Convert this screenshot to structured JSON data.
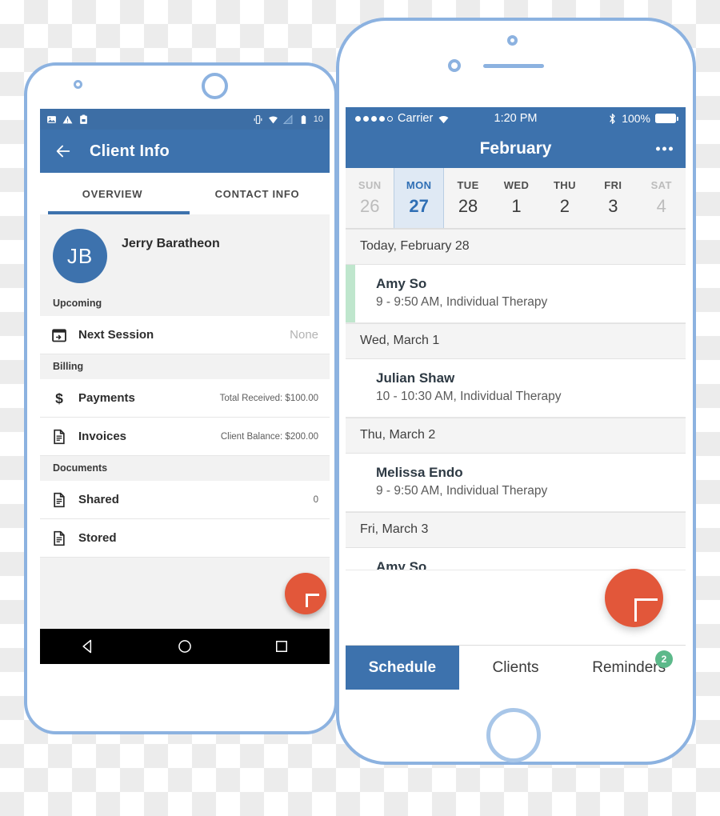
{
  "android": {
    "status_bar": {
      "left_icons": [
        "image-icon",
        "warning-icon",
        "clipboard-icon"
      ],
      "right_icons": [
        "vibrate-icon",
        "wifi-icon",
        "signal-icon",
        "battery-icon"
      ],
      "battery_text": "10"
    },
    "app_bar": {
      "back_icon": "back-arrow-icon",
      "title": "Client Info"
    },
    "tabs": [
      {
        "label": "OVERVIEW",
        "active": true
      },
      {
        "label": "CONTACT INFO",
        "active": false
      }
    ],
    "profile": {
      "initials": "JB",
      "name": "Jerry Baratheon"
    },
    "sections": [
      {
        "header": "Upcoming",
        "rows": [
          {
            "icon": "calendar-icon",
            "label": "Next Session",
            "value": "None",
            "muted": true
          }
        ]
      },
      {
        "header": "Billing",
        "rows": [
          {
            "icon": "dollar-icon",
            "label": "Payments",
            "value": "Total Received: $100.00",
            "muted": false
          },
          {
            "icon": "document-icon",
            "label": "Invoices",
            "value": "Client Balance: $200.00",
            "muted": false
          }
        ]
      },
      {
        "header": "Documents",
        "rows": [
          {
            "icon": "document-icon",
            "label": "Shared",
            "value": "0",
            "muted": false
          },
          {
            "icon": "document-icon",
            "label": "Stored",
            "value": "",
            "muted": false
          }
        ]
      }
    ],
    "fab": {
      "icon": "plus-icon",
      "color": "#e2573a"
    },
    "nav_bar": {
      "back": "triangle-back-icon",
      "home": "circle-home-icon",
      "recents": "square-recents-icon"
    }
  },
  "iphone": {
    "status_bar": {
      "carrier": "Carrier",
      "wifi_icon": "wifi-icon",
      "time": "1:20 PM",
      "bluetooth_icon": "bluetooth-icon",
      "battery_percent": "100%"
    },
    "nav_bar": {
      "title": "February",
      "more_icon": "more-options-icon"
    },
    "week": [
      {
        "name": "SUN",
        "num": "26",
        "selected": false,
        "weekend": true
      },
      {
        "name": "MON",
        "num": "27",
        "selected": true,
        "weekend": false
      },
      {
        "name": "TUE",
        "num": "28",
        "selected": false,
        "weekend": false
      },
      {
        "name": "WED",
        "num": "1",
        "selected": false,
        "weekend": false
      },
      {
        "name": "THU",
        "num": "2",
        "selected": false,
        "weekend": false
      },
      {
        "name": "FRI",
        "num": "3",
        "selected": false,
        "weekend": false
      },
      {
        "name": "SAT",
        "num": "4",
        "selected": false,
        "weekend": true
      }
    ],
    "schedule": [
      {
        "date_label": "Today, February 28",
        "appointments": [
          {
            "name": "Amy So",
            "detail": "9 - 9:50 AM, Individual Therapy",
            "accent": true,
            "partial": false
          }
        ]
      },
      {
        "date_label": "Wed, March 1",
        "appointments": [
          {
            "name": "Julian Shaw",
            "detail": "10 - 10:30 AM, Individual Therapy",
            "accent": false,
            "partial": false
          }
        ]
      },
      {
        "date_label": "Thu, March 2",
        "appointments": [
          {
            "name": "Melissa Endo",
            "detail": "9 - 9:50 AM, Individual Therapy",
            "accent": false,
            "partial": false
          }
        ]
      },
      {
        "date_label": "Fri, March 3",
        "appointments": [
          {
            "name": "Amy So",
            "detail": "",
            "accent": false,
            "partial": true
          }
        ]
      }
    ],
    "fab": {
      "icon": "plus-icon",
      "color": "#e2573a"
    },
    "tab_bar": [
      {
        "label": "Schedule",
        "active": true,
        "badge": ""
      },
      {
        "label": "Clients",
        "active": false,
        "badge": ""
      },
      {
        "label": "Reminders",
        "active": false,
        "badge": "2"
      }
    ]
  },
  "colors": {
    "brand_blue": "#3d72ad",
    "frame_blue": "#8cb2e0",
    "accent_orange": "#e2573a",
    "badge_green": "#5cb98a",
    "appt_accent_green": "#bfe6cd"
  }
}
